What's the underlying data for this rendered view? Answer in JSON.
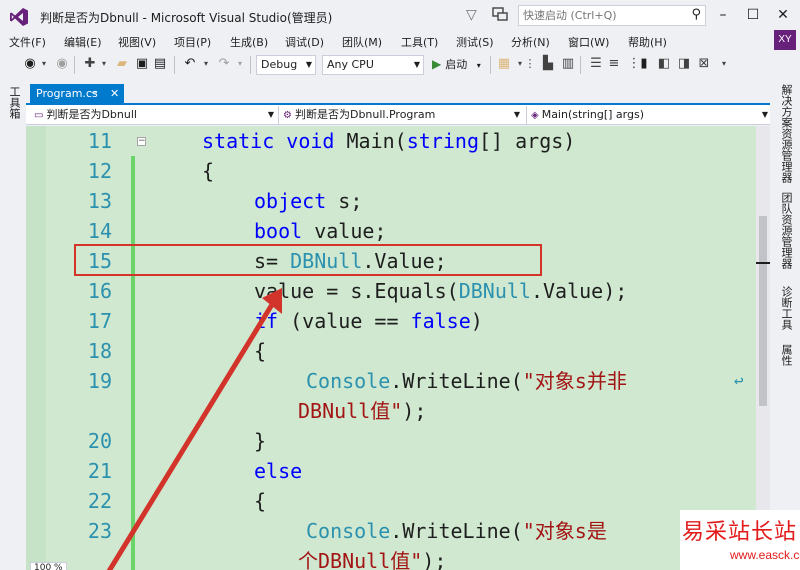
{
  "window": {
    "title": "判断是否为Dbnull - Microsoft Visual Studio(管理员)",
    "quick_launch_placeholder": "快速启动 (Ctrl+Q)",
    "user_initials": "XY"
  },
  "menu": [
    "文件(F)",
    "编辑(E)",
    "视图(V)",
    "项目(P)",
    "生成(B)",
    "调试(D)",
    "团队(M)",
    "工具(T)",
    "测试(S)",
    "分析(N)",
    "窗口(W)",
    "帮助(H)"
  ],
  "toolbar": {
    "configuration": "Debug",
    "platform": "Any CPU",
    "start_label": "启动"
  },
  "left_panel": {
    "toolbox": "工具箱"
  },
  "right_panel": [
    "解决方案资源管理器",
    "团队资源管理器",
    "诊断工具",
    "属性"
  ],
  "document": {
    "tab_name": "Program.cs",
    "nav_project": "判断是否为Dbnull",
    "nav_class": "判断是否为Dbnull.Program",
    "nav_member": "Main(string[] args)"
  },
  "code_lines": [
    {
      "num": "11",
      "indent": 3,
      "tokens": [
        {
          "t": "static ",
          "c": "kw"
        },
        {
          "t": "void ",
          "c": "kw"
        },
        {
          "t": "Main(",
          "c": ""
        },
        {
          "t": "string",
          "c": "kw"
        },
        {
          "t": "[] args)",
          "c": ""
        }
      ]
    },
    {
      "num": "12",
      "indent": 3,
      "tokens": [
        {
          "t": "{",
          "c": ""
        }
      ]
    },
    {
      "num": "13",
      "indent": 4,
      "tokens": [
        {
          "t": "object ",
          "c": "kw"
        },
        {
          "t": "s;",
          "c": ""
        }
      ]
    },
    {
      "num": "14",
      "indent": 4,
      "tokens": [
        {
          "t": "bool ",
          "c": "kw"
        },
        {
          "t": "value;",
          "c": ""
        }
      ]
    },
    {
      "num": "15",
      "indent": 4,
      "tokens": [
        {
          "t": "s= ",
          "c": ""
        },
        {
          "t": "DBNull",
          "c": "ty"
        },
        {
          "t": ".Value;",
          "c": ""
        }
      ]
    },
    {
      "num": "16",
      "indent": 4,
      "tokens": [
        {
          "t": "value = s.Equals(",
          "c": ""
        },
        {
          "t": "DBNull",
          "c": "ty"
        },
        {
          "t": ".Value);",
          "c": ""
        }
      ]
    },
    {
      "num": "17",
      "indent": 4,
      "tokens": [
        {
          "t": "if ",
          "c": "kw"
        },
        {
          "t": "(value == ",
          "c": ""
        },
        {
          "t": "false",
          "c": "kw"
        },
        {
          "t": ")",
          "c": ""
        }
      ]
    },
    {
      "num": "18",
      "indent": 4,
      "tokens": [
        {
          "t": "{",
          "c": ""
        }
      ]
    },
    {
      "num": "19",
      "indent": 5,
      "tokens": [
        {
          "t": "Console",
          "c": "ty"
        },
        {
          "t": ".WriteLine(",
          "c": ""
        },
        {
          "t": "\"对象s并非",
          "c": "st"
        }
      ],
      "wrap": true
    },
    {
      "num": "",
      "indent": 0,
      "cont": true,
      "tokens": [
        {
          "t": "DBNull值\"",
          "c": "st"
        },
        {
          "t": ");",
          "c": ""
        }
      ]
    },
    {
      "num": "20",
      "indent": 4,
      "tokens": [
        {
          "t": "}",
          "c": ""
        }
      ]
    },
    {
      "num": "21",
      "indent": 4,
      "tokens": [
        {
          "t": "else",
          "c": "kw"
        }
      ]
    },
    {
      "num": "22",
      "indent": 4,
      "tokens": [
        {
          "t": "{",
          "c": ""
        }
      ]
    },
    {
      "num": "23",
      "indent": 5,
      "tokens": [
        {
          "t": "Console",
          "c": "ty"
        },
        {
          "t": ".WriteLine(",
          "c": ""
        },
        {
          "t": "\"对象s是",
          "c": "st"
        }
      ]
    },
    {
      "num": "",
      "indent": 0,
      "cont": true,
      "tokens": [
        {
          "t": "个DBNull值\"",
          "c": "st"
        },
        {
          "t": ");",
          "c": ""
        }
      ]
    }
  ],
  "status": {
    "zoom": "100 %"
  },
  "watermark": {
    "text": "易采站长站",
    "url": "www.easck.com"
  },
  "colors": {
    "accent": "#007acc",
    "highlight": "#d2332b",
    "editor_bg": "#cfe8cf"
  }
}
